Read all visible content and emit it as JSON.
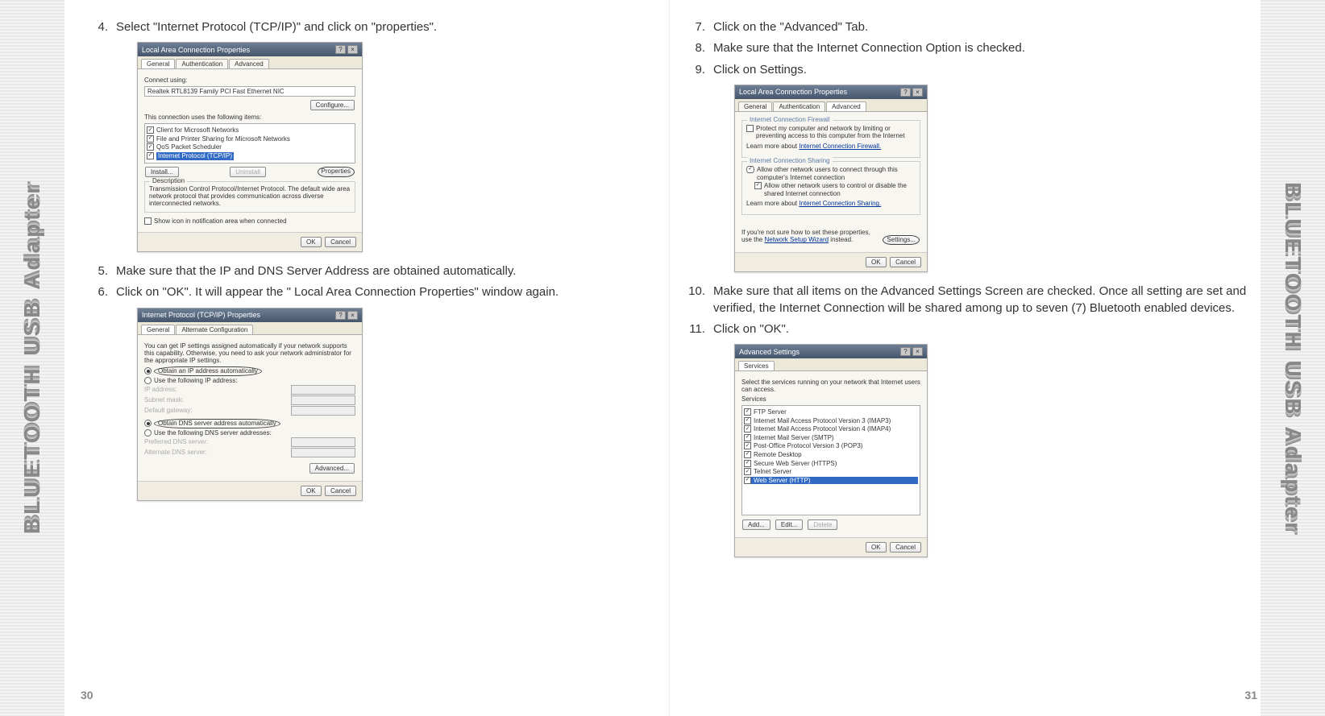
{
  "spine_text": "BLUETOOTH USB Adapter",
  "left": {
    "pagenum": "30",
    "step4": {
      "num": "4.",
      "txt": "Select \"Internet Protocol (TCP/IP)\" and click on \"properties\"."
    },
    "shot1": {
      "title": "Local Area Connection Properties",
      "tabs": [
        "General",
        "Authentication",
        "Advanced"
      ],
      "connect_using_label": "Connect using:",
      "connect_using_value": "Realtek RTL8139 Family PCI Fast Ethernet NIC",
      "configure_btn": "Configure...",
      "uses_label": "This connection uses the following items:",
      "items": [
        {
          "checked": true,
          "label": "Client for Microsoft Networks"
        },
        {
          "checked": true,
          "label": "File and Printer Sharing for Microsoft Networks"
        },
        {
          "checked": true,
          "label": "QoS Packet Scheduler"
        },
        {
          "checked": true,
          "label": "Internet Protocol (TCP/IP)",
          "selected": true
        }
      ],
      "install_btn": "Install...",
      "uninstall_btn": "Uninstall",
      "properties_btn": "Properties",
      "desc_title": "Description",
      "desc_text": "Transmission Control Protocol/Internet Protocol. The default wide area network protocol that provides communication across diverse interconnected networks.",
      "show_icon": "Show icon in notification area when connected",
      "ok": "OK",
      "cancel": "Cancel"
    },
    "step5": {
      "num": "5.",
      "txt": "Make sure that the IP and DNS Server Address are obtained automatically."
    },
    "step6": {
      "num": "6.",
      "txt": "Click on \"OK\". It will appear the \" Local Area Connection Properties\" window again."
    },
    "shot2": {
      "title": "Internet Protocol (TCP/IP) Properties",
      "tabs": [
        "General",
        "Alternate Configuration"
      ],
      "intro": "You can get IP settings assigned automatically if your network supports this capability. Otherwise, you need to ask your network administrator for the appropriate IP settings.",
      "r_obtain_ip": "Obtain an IP address automatically",
      "r_use_ip": "Use the following IP address:",
      "ip_label": "IP address:",
      "subnet_label": "Subnet mask:",
      "gateway_label": "Default gateway:",
      "r_obtain_dns": "Obtain DNS server address automatically",
      "r_use_dns": "Use the following DNS server addresses:",
      "pref_dns": "Preferred DNS server:",
      "alt_dns": "Alternate DNS server:",
      "advanced_btn": "Advanced...",
      "ok": "OK",
      "cancel": "Cancel"
    }
  },
  "right": {
    "pagenum": "31",
    "step7": {
      "num": "7.",
      "txt": "Click on the \"Advanced\" Tab."
    },
    "step8": {
      "num": "8.",
      "txt": "Make sure that the Internet Connection Option is checked."
    },
    "step9": {
      "num": "9.",
      "txt": "Click on Settings."
    },
    "shot3": {
      "title": "Local Area Connection Properties",
      "tabs": [
        "General",
        "Authentication",
        "Advanced"
      ],
      "icf_title": "Internet Connection Firewall",
      "icf_chk": "Protect my computer and network by limiting or preventing access to this computer from the Internet",
      "icf_learn": "Learn more about ",
      "icf_link": "Internet Connection Firewall.",
      "ics_title": "Internet Connection Sharing",
      "ics_chk1": "Allow other network users to connect through this computer's Internet connection",
      "ics_chk2": "Allow other network users to control or disable the shared Internet connection",
      "ics_learn": "Learn more about ",
      "ics_link": "Internet Connection Sharing.",
      "hint": "If you're not sure how to set these properties, use the ",
      "hint_link": "Network Setup Wizard",
      "hint_tail": " instead.",
      "settings_btn": "Settings...",
      "ok": "OK",
      "cancel": "Cancel"
    },
    "step10": {
      "num": "10.",
      "txt": "Make sure that all items on the Advanced Settings Screen are checked. Once all setting are set and verified, the Internet Connection will be shared among up to seven (7) Bluetooth enabled devices."
    },
    "step11": {
      "num": "11.",
      "txt": "Click on \"OK\"."
    },
    "shot4": {
      "title": "Advanced Settings",
      "tab": "Services",
      "intro": "Select the services running on your network that Internet users can access.",
      "services_label": "Services",
      "items": [
        "FTP Server",
        "Internet Mail Access Protocol Version 3 (IMAP3)",
        "Internet Mail Access Protocol Version 4 (IMAP4)",
        "Internet Mail Server (SMTP)",
        "Post-Office Protocol Version 3 (POP3)",
        "Remote Desktop",
        "Secure Web Server (HTTPS)",
        "Telnet Server",
        "Web Server (HTTP)"
      ],
      "add": "Add...",
      "edit": "Edit...",
      "delete": "Delete",
      "ok": "OK",
      "cancel": "Cancel"
    }
  }
}
